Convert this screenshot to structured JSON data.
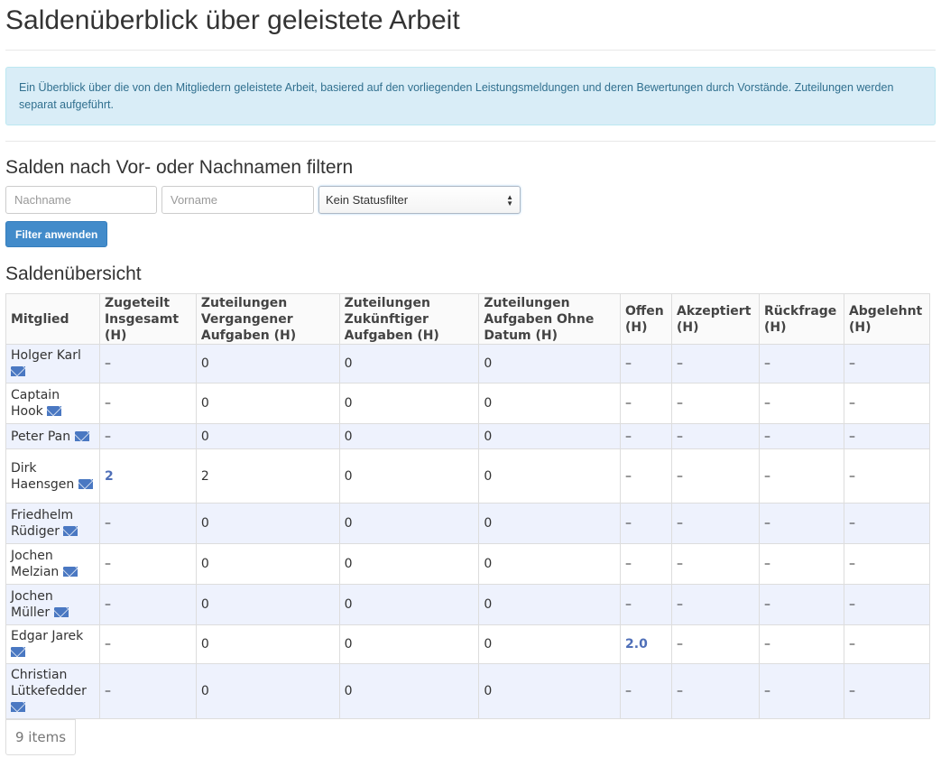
{
  "page": {
    "title": "Saldenüberblick über geleistete Arbeit",
    "info": "Ein Überblick über die von den Mitgliedern geleistete Arbeit, basiered auf den vorliegenden Leistungsmeldungen und deren Bewertungen durch Vorstände. Zuteilungen werden separat aufgeführt."
  },
  "filter": {
    "heading": "Salden nach Vor- oder Nachnamen filtern",
    "lastname_placeholder": "Nachname",
    "firstname_placeholder": "Vorname",
    "status_selected": "Kein Statusfilter",
    "apply_label": "Filter anwenden"
  },
  "table": {
    "heading": "Saldenübersicht",
    "headers": [
      "Mitglied",
      "Zugeteilt Insgesamt (H)",
      "Zuteilungen Vergangener Aufgaben (H)",
      "Zuteilungen Zukünftiger Aufgaben (H)",
      "Zuteilungen Aufgaben Ohne Datum (H)",
      "Offen (H)",
      "Akzeptiert (H)",
      "Rückfrage (H)",
      "Abgelehnt (H)"
    ],
    "rows": [
      {
        "member": "Holger Karl",
        "cells": [
          "–",
          "0",
          "0",
          "0",
          "–",
          "–",
          "–",
          "–"
        ]
      },
      {
        "member": "Captain Hook",
        "cells": [
          "–",
          "0",
          "0",
          "0",
          "–",
          "–",
          "–",
          "–"
        ]
      },
      {
        "member": "Peter Pan",
        "cells": [
          "–",
          "0",
          "0",
          "0",
          "–",
          "–",
          "–",
          "–"
        ]
      },
      {
        "member": "Dirk Haensgen",
        "cells": [
          "2",
          "2",
          "0",
          "0",
          "–",
          "–",
          "–",
          "–"
        ]
      },
      {
        "member": "Friedhelm Rüdiger",
        "cells": [
          "–",
          "0",
          "0",
          "0",
          "–",
          "–",
          "–",
          "–"
        ]
      },
      {
        "member": "Jochen Melzian",
        "cells": [
          "–",
          "0",
          "0",
          "0",
          "–",
          "–",
          "–",
          "–"
        ]
      },
      {
        "member": "Jochen Müller",
        "cells": [
          "–",
          "0",
          "0",
          "0",
          "–",
          "–",
          "–",
          "–"
        ]
      },
      {
        "member": "Edgar Jarek",
        "cells": [
          "–",
          "0",
          "0",
          "0",
          "2.0",
          "–",
          "–",
          "–"
        ]
      },
      {
        "member": "Christian Lütkefedder",
        "cells": [
          "–",
          "0",
          "0",
          "0",
          "–",
          "–",
          "–",
          "–"
        ]
      }
    ],
    "item_count": "9 items"
  }
}
